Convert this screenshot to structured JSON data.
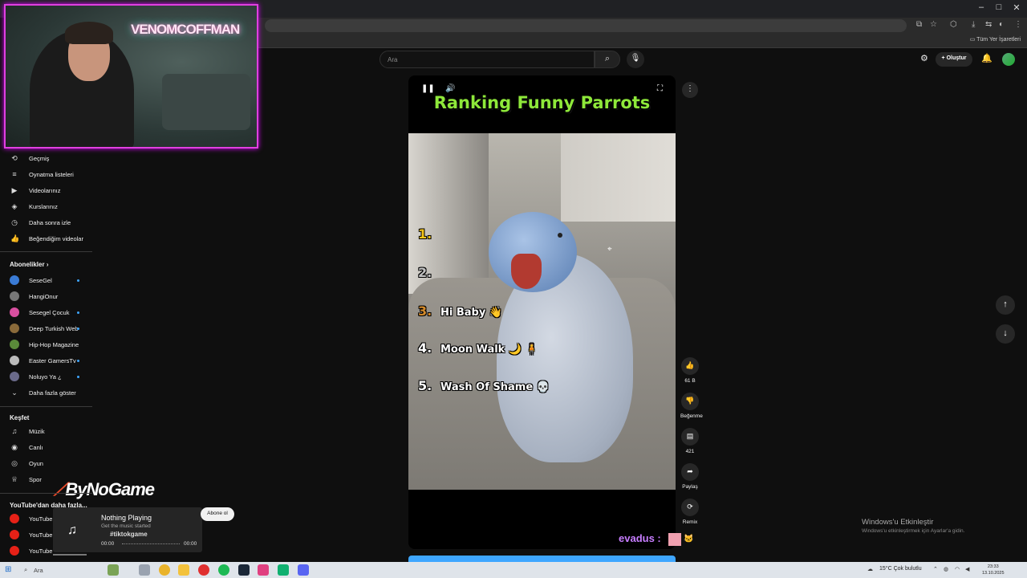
{
  "window": {
    "minimize": "–",
    "maximize": "□",
    "close": "✕"
  },
  "browser": {
    "bookmarks_all": "Tüm Yer İşaretleri"
  },
  "header": {
    "search_placeholder": "Ara",
    "create_label": "Oluştur",
    "icons": [
      "search-icon",
      "mic-icon",
      "plus-icon",
      "bell-icon",
      "cast-icon"
    ]
  },
  "webcam": {
    "neon_sign": "VENOMCOFFMAN"
  },
  "sidebar": {
    "you_items": [
      {
        "label": "Geçmiş",
        "icon": "history-icon",
        "glyph": "⟲"
      },
      {
        "label": "Oynatma listeleri",
        "icon": "playlist-icon",
        "glyph": "≡"
      },
      {
        "label": "Videolarınız",
        "icon": "video-icon",
        "glyph": "▶"
      },
      {
        "label": "Kurslarınız",
        "icon": "courses-icon",
        "glyph": "◈"
      },
      {
        "label": "Daha sonra izle",
        "icon": "clock-icon",
        "glyph": "◷"
      },
      {
        "label": "Beğendiğim videolar",
        "icon": "thumbs-up-icon",
        "glyph": "👍"
      }
    ],
    "subs_title": "Abonelikler",
    "subscriptions": [
      {
        "label": "SeseGel",
        "color": "#3a7bd5",
        "dot": true
      },
      {
        "label": "HangiOnur",
        "color": "#777777",
        "dot": false
      },
      {
        "label": "Sesegel Çocuk",
        "color": "#d94fa0",
        "dot": true
      },
      {
        "label": "Deep Turkish Web",
        "color": "#8a6a3a",
        "dot": true
      },
      {
        "label": "Hip-Hop Magazine",
        "color": "#5a8a3a",
        "dot": false
      },
      {
        "label": "Easter GamersTv",
        "color": "#bbbbbb",
        "dot": true
      },
      {
        "label": "Noluyo Ya ¿",
        "color": "#6a6a8a",
        "dot": true
      }
    ],
    "show_more": "Daha fazla göster",
    "explore_title": "Keşfet",
    "explore": [
      {
        "label": "Müzik",
        "icon": "music-icon",
        "glyph": "♫"
      },
      {
        "label": "Canlı",
        "icon": "live-icon",
        "glyph": "◉"
      },
      {
        "label": "Oyun",
        "icon": "gaming-icon",
        "glyph": "◎"
      },
      {
        "label": "Spor",
        "icon": "trophy-icon",
        "glyph": "♕"
      }
    ],
    "more_title": "YouTube'dan daha fazla...",
    "more_items": [
      "YouTube",
      "YouTube",
      "YouTube"
    ]
  },
  "overlay": {
    "brand": "ByNoGame",
    "now_playing_title": "Nothing Playing",
    "now_playing_sub": "Get the music started",
    "time_start": "00:00",
    "time_end": "00:00",
    "tiktok_tag": "#tiktokgame",
    "subscribe": "Abone ol"
  },
  "short": {
    "title": "Ranking Funny Parrots",
    "ranks": [
      {
        "num": "1.",
        "text": "",
        "color": "#f5c518"
      },
      {
        "num": "2.",
        "text": "",
        "color": "#c0c0c0"
      },
      {
        "num": "3.",
        "text": "Hi Baby 👋",
        "color": "#d48a2a"
      },
      {
        "num": "4.",
        "text": "Moon Walk 🌙 🧍",
        "color": "#ffffff"
      },
      {
        "num": "5.",
        "text": "Wash Of Shame 💀",
        "color": "#ffffff"
      }
    ]
  },
  "actions": {
    "likes": "61 B",
    "dislike": "Beğenme",
    "comments": "421",
    "share": "Paylaş",
    "remix": "Remix"
  },
  "chat": {
    "user": "evadus :",
    "emote2": "🐱"
  },
  "activation": {
    "title": "Windows'u Etkinleştir",
    "subtitle": "Windows'u etkinleştirmek için Ayarlar'a gidin."
  },
  "taskbar": {
    "search": "Ara",
    "weather": "15°C  Çok bulutlu",
    "time": "23:33",
    "date": "13.10.2025"
  }
}
